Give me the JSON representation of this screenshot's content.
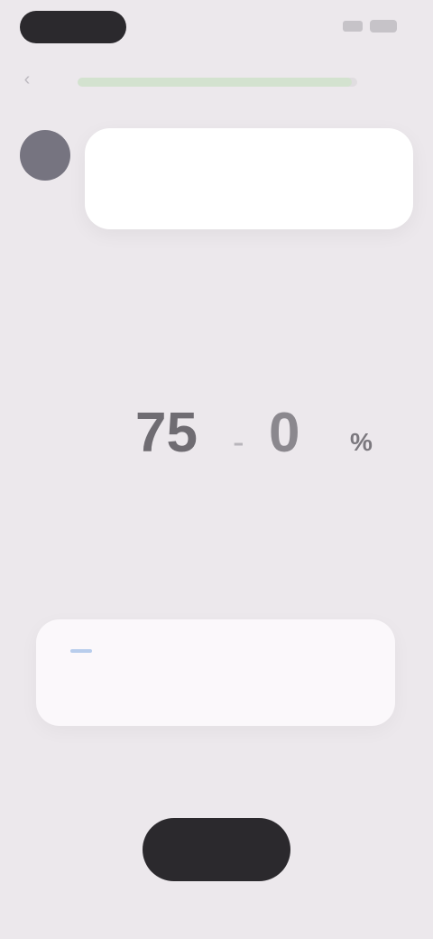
{
  "status_bar": {
    "time": ""
  },
  "progress": {
    "value": 0.98
  },
  "question": {
    "text": ""
  },
  "picker": {
    "hint": "",
    "label": "",
    "year_value": "75",
    "separator": "-",
    "month_value": "0",
    "unit": "%",
    "year_unit": "",
    "month_unit": "",
    "unit_unit": ""
  },
  "info": {
    "line1_text": "",
    "line1_highlight": "",
    "line2_text": "",
    "footer_note": ""
  },
  "cta": {
    "label": ""
  },
  "colors": {
    "background": "#ece8ec",
    "cta": "#2b292d",
    "highlight": "#b8cdec",
    "progress": "#d3e2cf"
  }
}
